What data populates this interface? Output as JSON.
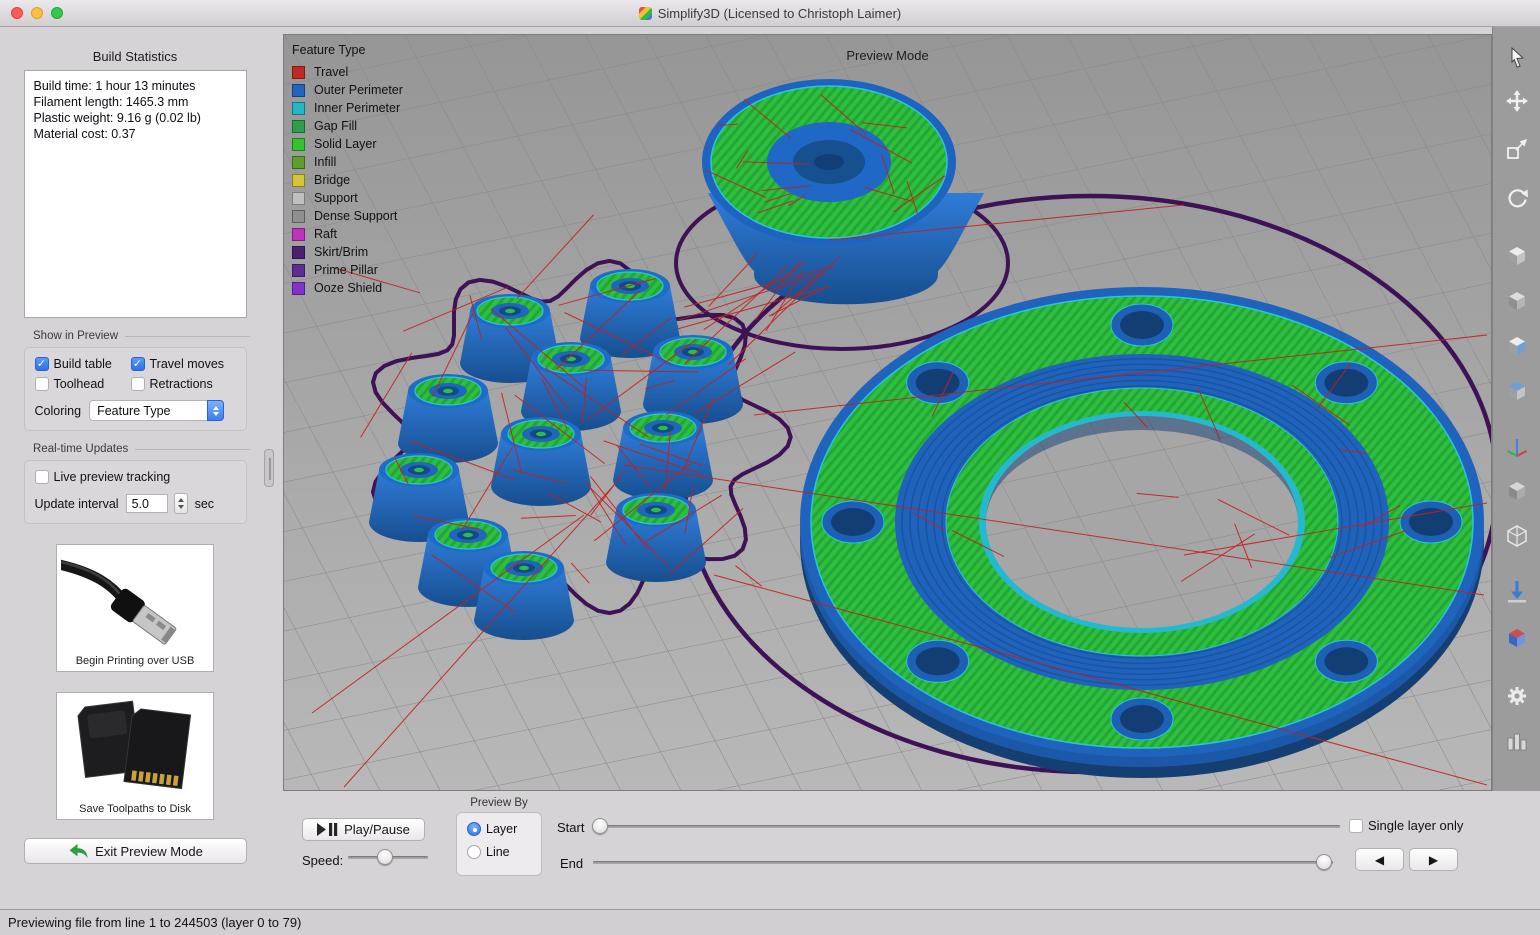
{
  "window": {
    "title": "Simplify3D (Licensed to Christoph Laimer)"
  },
  "sidebar": {
    "build_statistics": {
      "title": "Build Statistics",
      "lines": [
        "Build time: 1 hour 13 minutes",
        "Filament length: 1465.3 mm",
        "Plastic weight: 9.16 g (0.02 lb)",
        "Material cost: 0.37"
      ]
    },
    "show_in_preview": {
      "title": "Show in Preview",
      "checkboxes": [
        {
          "label": "Build table",
          "checked": true
        },
        {
          "label": "Travel moves",
          "checked": true
        },
        {
          "label": "Toolhead",
          "checked": false
        },
        {
          "label": "Retractions",
          "checked": false
        }
      ],
      "coloring_label": "Coloring",
      "coloring_value": "Feature Type"
    },
    "realtime": {
      "title": "Real-time Updates",
      "live_label": "Live preview tracking",
      "live_checked": false,
      "interval_label": "Update interval",
      "interval_value": "5.0",
      "interval_unit": "sec"
    },
    "usb_caption": "Begin Printing over USB",
    "disk_caption": "Save Toolpaths to Disk",
    "exit_label": "Exit Preview Mode"
  },
  "viewport": {
    "mode_label": "Preview Mode",
    "legend": {
      "title": "Feature Type",
      "items": [
        {
          "label": "Travel",
          "color": "#c02a25"
        },
        {
          "label": "Outer Perimeter",
          "color": "#2563c0"
        },
        {
          "label": "Inner Perimeter",
          "color": "#23b6c4"
        },
        {
          "label": "Gap Fill",
          "color": "#2e9e4a"
        },
        {
          "label": "Solid Layer",
          "color": "#33c32f"
        },
        {
          "label": "Infill",
          "color": "#5d9e2e"
        },
        {
          "label": "Bridge",
          "color": "#d5c433"
        },
        {
          "label": "Support",
          "color": "#bfbfbf"
        },
        {
          "label": "Dense Support",
          "color": "#8f8f8f"
        },
        {
          "label": "Raft",
          "color": "#bf32bf"
        },
        {
          "label": "Skirt/Brim",
          "color": "#4b2070"
        },
        {
          "label": "Prime Pillar",
          "color": "#5e2d91"
        },
        {
          "label": "Ooze Shield",
          "color": "#8233c9"
        }
      ]
    }
  },
  "toolbar": {
    "tools": [
      "cursor-tool",
      "pan-tool",
      "scale-tool",
      "rotate-tool",
      "view-cube-iso",
      "view-cube-shaded",
      "view-cube-front",
      "view-cube-side",
      "axes-indicator",
      "cube-solid",
      "cube-wireframe",
      "drop-to-table",
      "cross-section",
      "settings-gear",
      "layer-columns"
    ]
  },
  "controls": {
    "play_pause": "Play/Pause",
    "speed_label": "Speed:",
    "preview_by": {
      "title": "Preview By",
      "options": [
        {
          "label": "Layer",
          "selected": true
        },
        {
          "label": "Line",
          "selected": false
        }
      ]
    },
    "start_label": "Start",
    "end_label": "End",
    "single_layer": "Single layer only"
  },
  "statusbar": {
    "text": "Previewing file from line 1 to 244503 (layer 0 to 79)"
  }
}
